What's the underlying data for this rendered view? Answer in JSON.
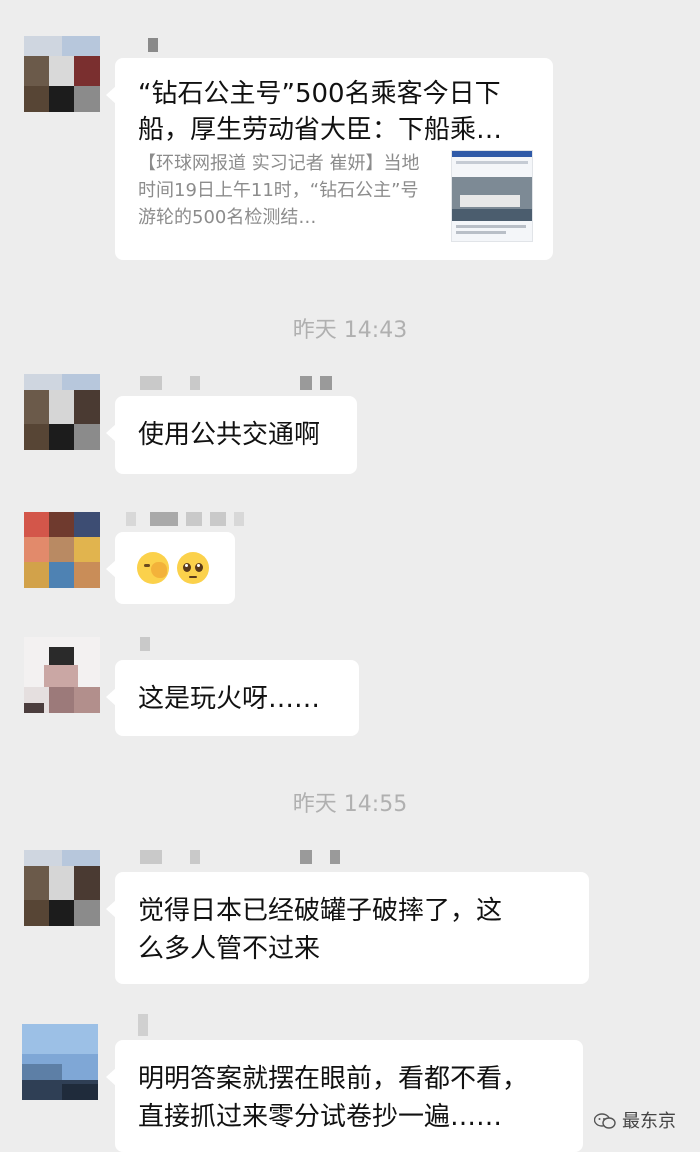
{
  "messages": [
    {
      "type": "link_card",
      "card_title": "“钻石公主号”500名乘客今日下船，厚生劳动省大臣：下船乘…",
      "card_desc": "【环球网报道 实习记者 崔妍】当地时间19日上午11时，“钻石公主”号游轮的500名检测结…"
    },
    {
      "type": "timestamp",
      "text": "昨天 14:43"
    },
    {
      "type": "text",
      "text": "使用公共交通啊"
    },
    {
      "type": "emoji",
      "emojis": [
        "facepalm-emoji",
        "pleading-face-emoji"
      ]
    },
    {
      "type": "text",
      "text": "这是玩火呀……"
    },
    {
      "type": "timestamp",
      "text": "昨天 14:55"
    },
    {
      "type": "text",
      "text": "觉得日本已经破罐子破摔了，这\n么多人管不过来"
    },
    {
      "type": "text",
      "text": "明明答案就摆在眼前，看都不看，\n直接抓过来零分试卷抄一遍……"
    }
  ],
  "watermark": {
    "text": "最东京",
    "icon": "wechat-icon"
  }
}
